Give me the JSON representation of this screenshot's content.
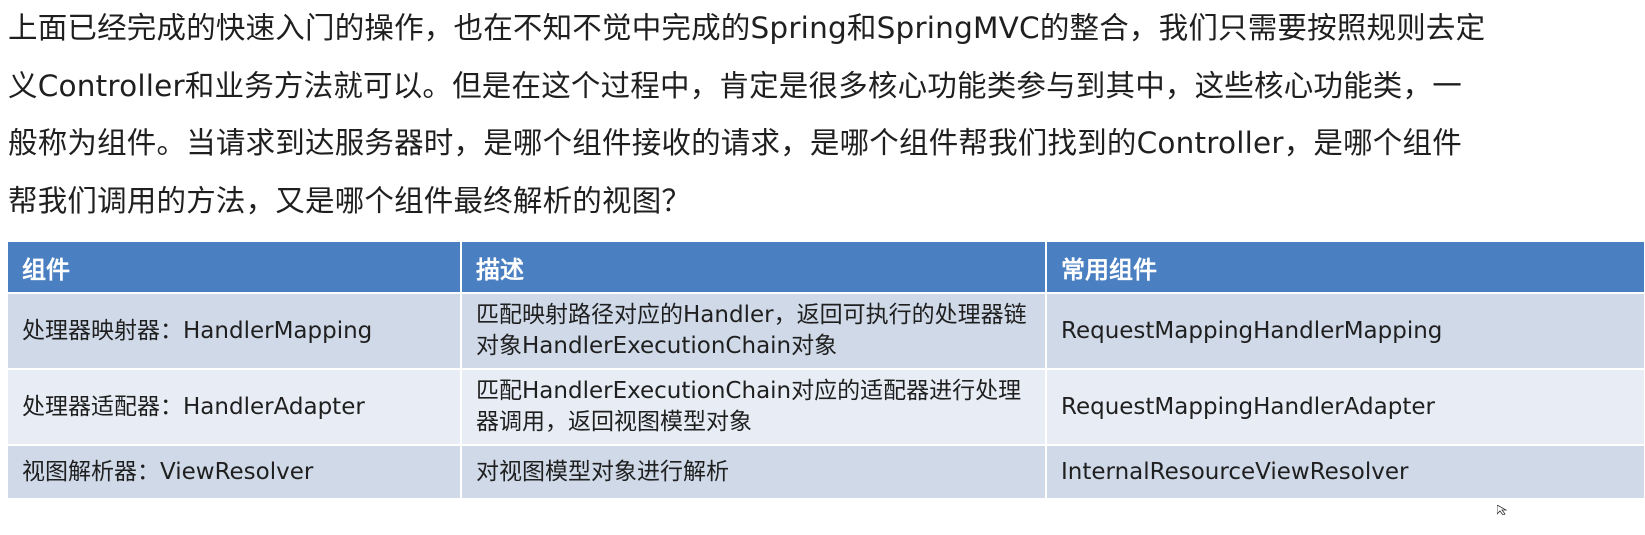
{
  "intro": {
    "lines": [
      "上面已经完成的快速入门的操作，也在不知不觉中完成的Spring和SpringMVC的整合，我们只需要按照规则去定",
      "义Controller和业务方法就可以。但是在这个过程中，肯定是很多核心功能类参与到其中，这些核心功能类，一",
      "般称为组件。当请求到达服务器时，是哪个组件接收的请求，是哪个组件帮我们找到的Controller，是哪个组件",
      "帮我们调用的方法，又是哪个组件最终解析的视图？"
    ]
  },
  "table": {
    "headers": [
      "组件",
      "描述",
      "常用组件"
    ],
    "rows": [
      {
        "component": "处理器映射器：HandlerMapping",
        "description": "匹配映射路径对应的Handler，返回可执行的处理器链对象HandlerExecutionChain对象",
        "common": "RequestMappingHandlerMapping"
      },
      {
        "component": "处理器适配器：HandlerAdapter",
        "description": "匹配HandlerExecutionChain对应的适配器进行处理器调用，返回视图模型对象",
        "common": "RequestMappingHandlerAdapter"
      },
      {
        "component": "视图解析器：ViewResolver",
        "description": "对视图模型对象进行解析",
        "common": "InternalResourceViewResolver"
      }
    ]
  },
  "colors": {
    "header_bg": "#4a7fc1",
    "row_dark": "#cfd9e8",
    "row_light": "#e8edf5"
  }
}
